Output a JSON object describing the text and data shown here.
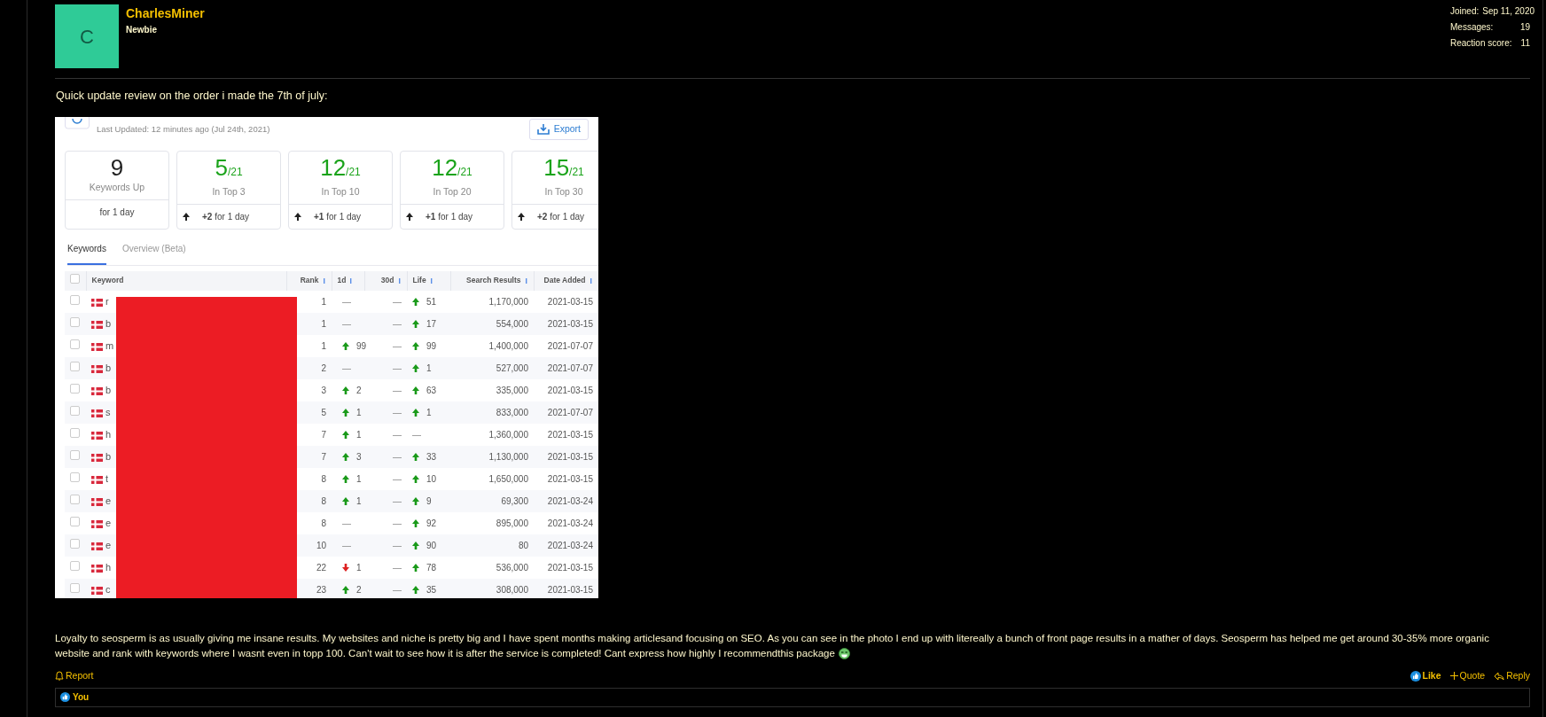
{
  "author": {
    "initial": "C",
    "username": "CharlesMiner",
    "title": "Newbie"
  },
  "stats": [
    {
      "label": "Joined:",
      "value": "Sep 11, 2020"
    },
    {
      "label": "Messages:",
      "value": "19"
    },
    {
      "label": "Reaction score:",
      "value": "11"
    }
  ],
  "intro": "Quick update review on the order i made the 7th of july:",
  "screenshot": {
    "updated": "Last Updated: 12 minutes ago (Jul 24th, 2021)",
    "export": "Export",
    "cards": [
      {
        "kind": "count",
        "value": "9",
        "label": "Keywords Up",
        "period": "for 1 day"
      },
      {
        "kind": "ratio",
        "value": "5",
        "total": "/21",
        "label": "In Top 3",
        "delta": "+2",
        "period": "for 1 day"
      },
      {
        "kind": "ratio",
        "value": "12",
        "total": "/21",
        "label": "In Top 10",
        "delta": "+1",
        "period": "for 1 day"
      },
      {
        "kind": "ratio",
        "value": "12",
        "total": "/21",
        "label": "In Top 20",
        "delta": "+1",
        "period": "for 1 day"
      },
      {
        "kind": "ratio",
        "value": "15",
        "total": "/21",
        "label": "In Top 30",
        "delta": "+2",
        "period": "for 1 day"
      }
    ],
    "tabs": [
      {
        "label": "Keywords",
        "selected": true
      },
      {
        "label": "Overview (Beta)",
        "selected": false
      }
    ],
    "all_selected": false,
    "columns": [
      "Keyword",
      "Rank",
      "1d",
      "30d",
      "Life",
      "Search Results",
      "Date Added"
    ],
    "rows": [
      {
        "selected": false,
        "keyword": "r",
        "rank": "1",
        "d1": {
          "kind": "none",
          "text": "—"
        },
        "d30": {
          "kind": "none",
          "text": "—"
        },
        "life": {
          "kind": "up",
          "text": "51"
        },
        "results": "1,170,000",
        "date": "2021-03-15"
      },
      {
        "selected": false,
        "keyword": "b",
        "rank": "1",
        "d1": {
          "kind": "none",
          "text": "—"
        },
        "d30": {
          "kind": "none",
          "text": "—"
        },
        "life": {
          "kind": "up",
          "text": "17"
        },
        "results": "554,000",
        "date": "2021-03-15"
      },
      {
        "selected": false,
        "keyword": "m",
        "rank": "1",
        "d1": {
          "kind": "up",
          "text": "99"
        },
        "d30": {
          "kind": "none",
          "text": "—"
        },
        "life": {
          "kind": "up",
          "text": "99"
        },
        "results": "1,400,000",
        "date": "2021-07-07"
      },
      {
        "selected": false,
        "keyword": "b",
        "rank": "2",
        "d1": {
          "kind": "none",
          "text": "—"
        },
        "d30": {
          "kind": "none",
          "text": "—"
        },
        "life": {
          "kind": "up",
          "text": "1"
        },
        "results": "527,000",
        "date": "2021-07-07"
      },
      {
        "selected": false,
        "keyword": "b",
        "rank": "3",
        "d1": {
          "kind": "up",
          "text": "2"
        },
        "d30": {
          "kind": "none",
          "text": "—"
        },
        "life": {
          "kind": "up",
          "text": "63"
        },
        "results": "335,000",
        "date": "2021-03-15"
      },
      {
        "selected": false,
        "keyword": "s",
        "rank": "5",
        "d1": {
          "kind": "up",
          "text": "1"
        },
        "d30": {
          "kind": "none",
          "text": "—"
        },
        "life": {
          "kind": "up",
          "text": "1"
        },
        "results": "833,000",
        "date": "2021-07-07"
      },
      {
        "selected": false,
        "keyword": "h",
        "rank": "7",
        "d1": {
          "kind": "up",
          "text": "1"
        },
        "d30": {
          "kind": "none",
          "text": "—"
        },
        "life": {
          "kind": "none",
          "text": "—"
        },
        "results": "1,360,000",
        "date": "2021-03-15"
      },
      {
        "selected": false,
        "keyword": "b",
        "rank": "7",
        "d1": {
          "kind": "up",
          "text": "3"
        },
        "d30": {
          "kind": "none",
          "text": "—"
        },
        "life": {
          "kind": "up",
          "text": "33"
        },
        "results": "1,130,000",
        "date": "2021-03-15"
      },
      {
        "selected": false,
        "keyword": "t",
        "rank": "8",
        "d1": {
          "kind": "up",
          "text": "1"
        },
        "d30": {
          "kind": "none",
          "text": "—"
        },
        "life": {
          "kind": "up",
          "text": "10"
        },
        "results": "1,650,000",
        "date": "2021-03-15"
      },
      {
        "selected": false,
        "keyword": "e",
        "rank": "8",
        "d1": {
          "kind": "up",
          "text": "1"
        },
        "d30": {
          "kind": "none",
          "text": "—"
        },
        "life": {
          "kind": "up",
          "text": "9"
        },
        "results": "69,300",
        "date": "2021-03-24"
      },
      {
        "selected": false,
        "keyword": "e",
        "rank": "8",
        "d1": {
          "kind": "none",
          "text": "—"
        },
        "d30": {
          "kind": "none",
          "text": "—"
        },
        "life": {
          "kind": "up",
          "text": "92"
        },
        "results": "895,000",
        "date": "2021-03-24"
      },
      {
        "selected": false,
        "keyword": "e",
        "rank": "10",
        "d1": {
          "kind": "none",
          "text": "—"
        },
        "d30": {
          "kind": "none",
          "text": "—"
        },
        "life": {
          "kind": "up",
          "text": "90"
        },
        "results": "80",
        "date": "2021-03-24"
      },
      {
        "selected": false,
        "keyword": "h",
        "rank": "22",
        "d1": {
          "kind": "down",
          "text": "1"
        },
        "d30": {
          "kind": "none",
          "text": "—"
        },
        "life": {
          "kind": "up",
          "text": "78"
        },
        "results": "536,000",
        "date": "2021-03-15"
      },
      {
        "selected": false,
        "keyword": "c",
        "rank": "23",
        "d1": {
          "kind": "up",
          "text": "2"
        },
        "d30": {
          "kind": "none",
          "text": "—"
        },
        "life": {
          "kind": "up",
          "text": "35"
        },
        "results": "308,000",
        "date": "2021-03-15"
      }
    ]
  },
  "body_lines": [
    "Loyalty to seosperm is as usually giving me insane results. My websites and niche is pretty big and I have spent months making articlesand focusing on SEO. As you can see in the photo I end up with litereally a bunch of front page results in a mather of days. Seosperm has helped me get around 30-35% more organic",
    "website and rank with keywords where I wasnt even in topp 100. Can't wait to see how it is after the service is completed! Cant express how highly I recommendthis package"
  ],
  "actions": {
    "report": "Report",
    "like": "Like",
    "quote": "Quote",
    "reply": "Reply"
  },
  "reactions": {
    "who": "You"
  }
}
